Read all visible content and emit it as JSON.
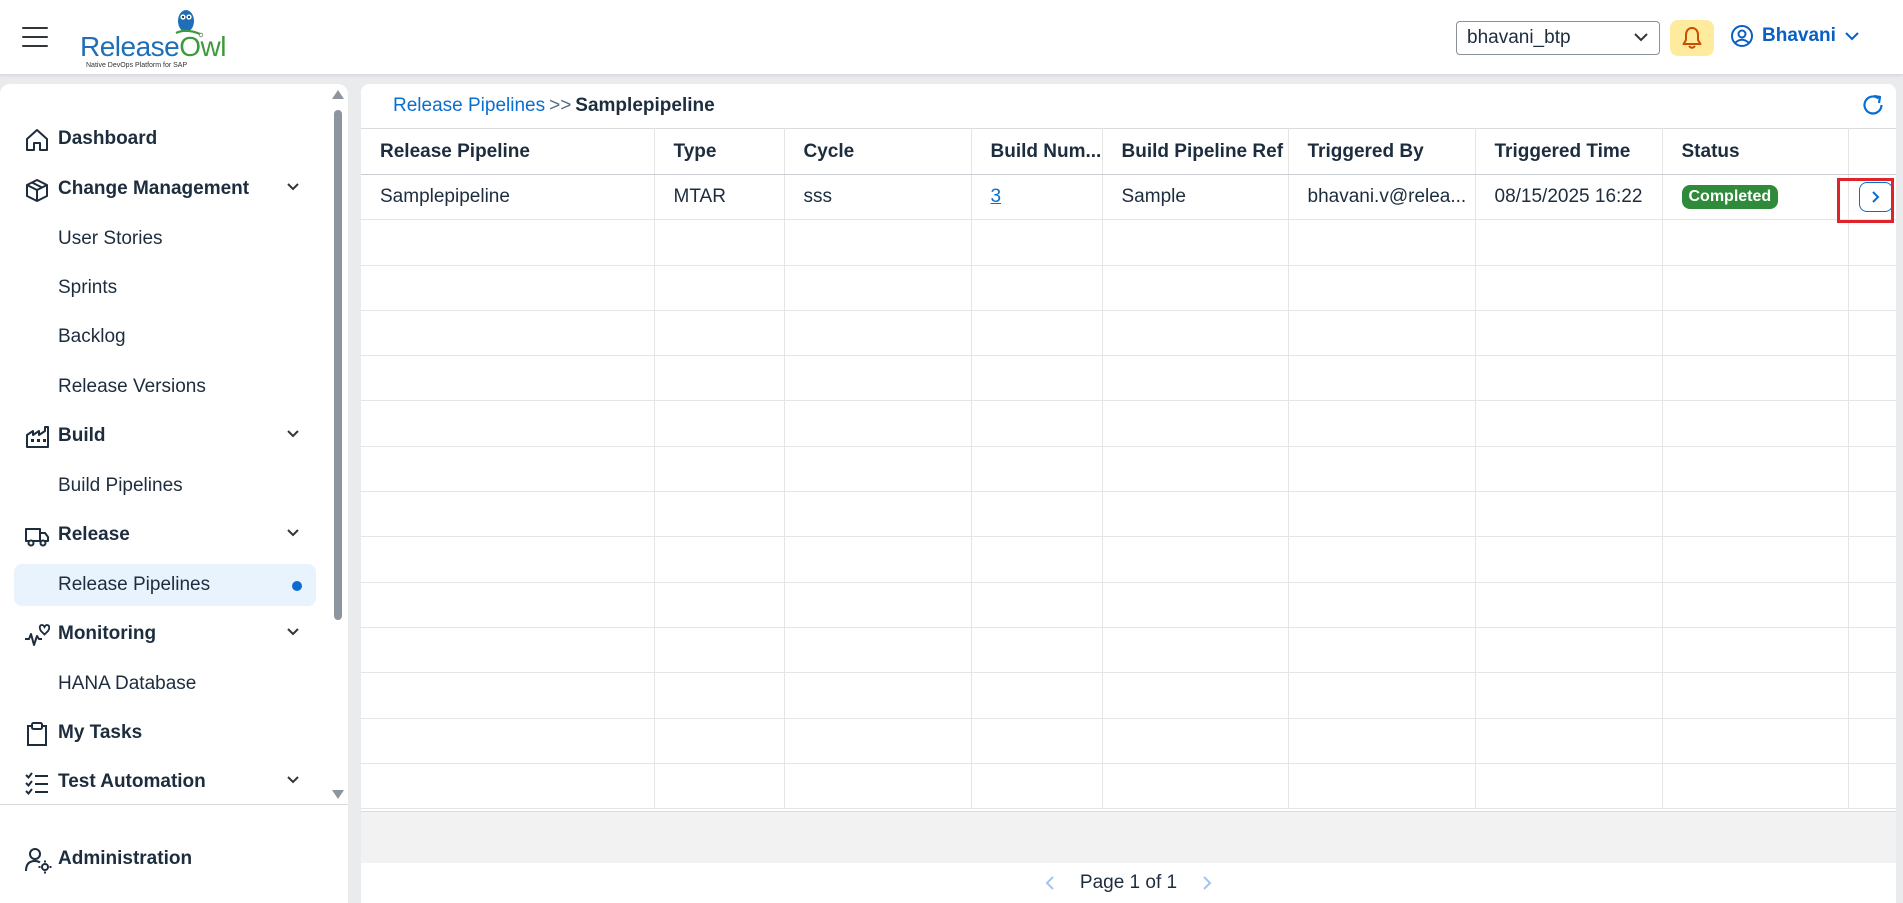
{
  "header": {
    "logo_release": "Release",
    "logo_owl": "Owl",
    "logo_tagline": "Native DevOps Platform for SAP",
    "tenant_value": "bhavani_btp",
    "user_name": "Bhavani"
  },
  "sidebar": {
    "items": [
      {
        "label": "Dashboard"
      },
      {
        "label": "Change Management"
      },
      {
        "label": "User Stories"
      },
      {
        "label": "Sprints"
      },
      {
        "label": "Backlog"
      },
      {
        "label": "Release Versions"
      },
      {
        "label": "Build"
      },
      {
        "label": "Build Pipelines"
      },
      {
        "label": "Release"
      },
      {
        "label": "Release Pipelines"
      },
      {
        "label": "Monitoring"
      },
      {
        "label": "HANA Database"
      },
      {
        "label": "My Tasks"
      },
      {
        "label": "Test Automation"
      }
    ],
    "admin_label": "Administration"
  },
  "breadcrumb": {
    "link": "Release Pipelines",
    "separator": ">>",
    "current": "Samplepipeline"
  },
  "table": {
    "columns": [
      "Release Pipeline",
      "Type",
      "Cycle",
      "Build Num...",
      "Build Pipeline Ref",
      "Triggered By",
      "Triggered Time",
      "Status"
    ],
    "rows": [
      {
        "release_pipeline": "Samplepipeline",
        "type": "MTAR",
        "cycle": "sss",
        "build_number": "3",
        "build_pipeline_ref": "Sample",
        "triggered_by": "bhavani.v@relea...",
        "triggered_time": "08/15/2025 16:22",
        "status": "Completed"
      }
    ]
  },
  "pager": {
    "text": "Page 1 of 1"
  },
  "colors": {
    "accent": "#0a6ed1",
    "status_completed": "#2f8b3a",
    "notification_bg": "#ffeb9e",
    "highlight": "#e0222a"
  }
}
